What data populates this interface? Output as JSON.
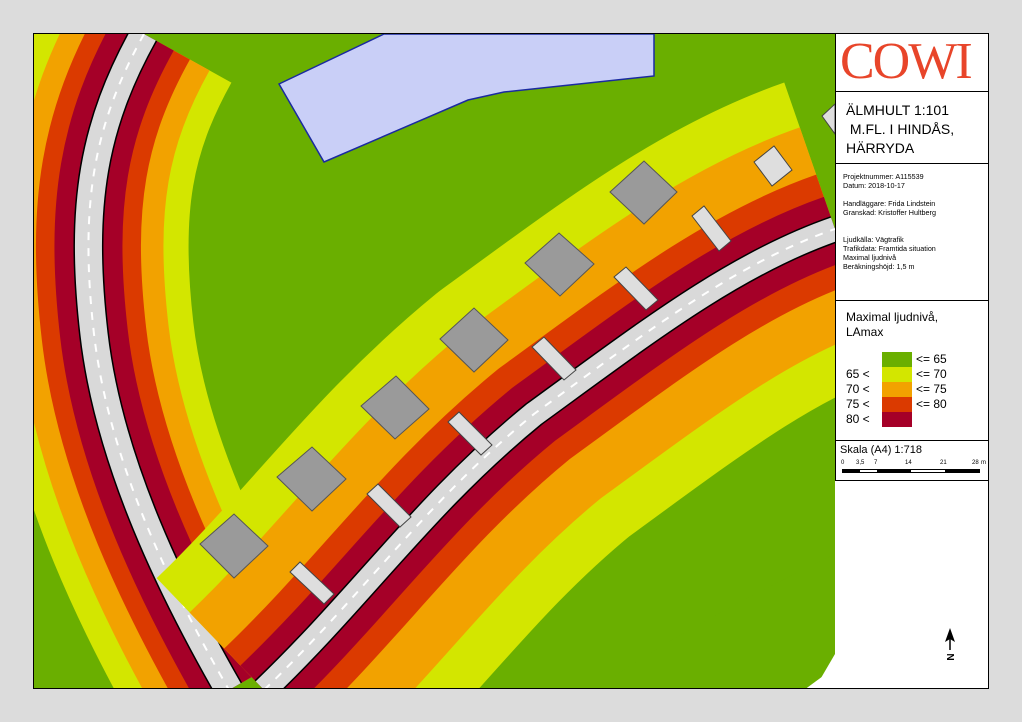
{
  "logo": "COWI",
  "title": {
    "line1": "ÄLMHULT 1:101",
    "line2": " M.FL. I HINDÅS,",
    "line3": "HÄRRYDA"
  },
  "meta": {
    "project": "Projektnummer: A115539",
    "date": "Datum: 2018-10-17",
    "handler": "Handläggare: Frida Lindstein",
    "reviewer": "Granskad: Kristoffer Hultberg",
    "source": "Ljudkälla: Vägtrafik",
    "traffic": "Trafikdata: Framtida situation",
    "level": "Maximal ljudnivå",
    "height": "Beräkningshöjd: 1,5 m"
  },
  "legend": {
    "title1": "Maximal ljudnivå,",
    "title2": "LAmax",
    "classes": [
      {
        "low": "",
        "high": "<= 65",
        "color": "#6aaf00"
      },
      {
        "low": "65 <",
        "high": "<= 70",
        "color": "#d3e600"
      },
      {
        "low": "70 <",
        "high": "<= 75",
        "color": "#f2a200"
      },
      {
        "low": "75 <",
        "high": "<= 80",
        "color": "#db3a00"
      },
      {
        "low": "80 <",
        "high": "",
        "color": "#a50028"
      }
    ]
  },
  "scale": {
    "title": "Skala (A4) 1:718",
    "ticks": [
      "0",
      "3,5",
      "7",
      "14",
      "21",
      "28"
    ],
    "unit": "m"
  },
  "north": "N",
  "colors": {
    "green": "#6aaf00",
    "yellow": "#d3e600",
    "orange": "#f2a200",
    "red": "#db3a00",
    "darkred": "#a50028",
    "road": "#d9d9d9",
    "building": "#9a9a9a",
    "garage": "#d9d9d9",
    "water": "#c9cff7"
  }
}
